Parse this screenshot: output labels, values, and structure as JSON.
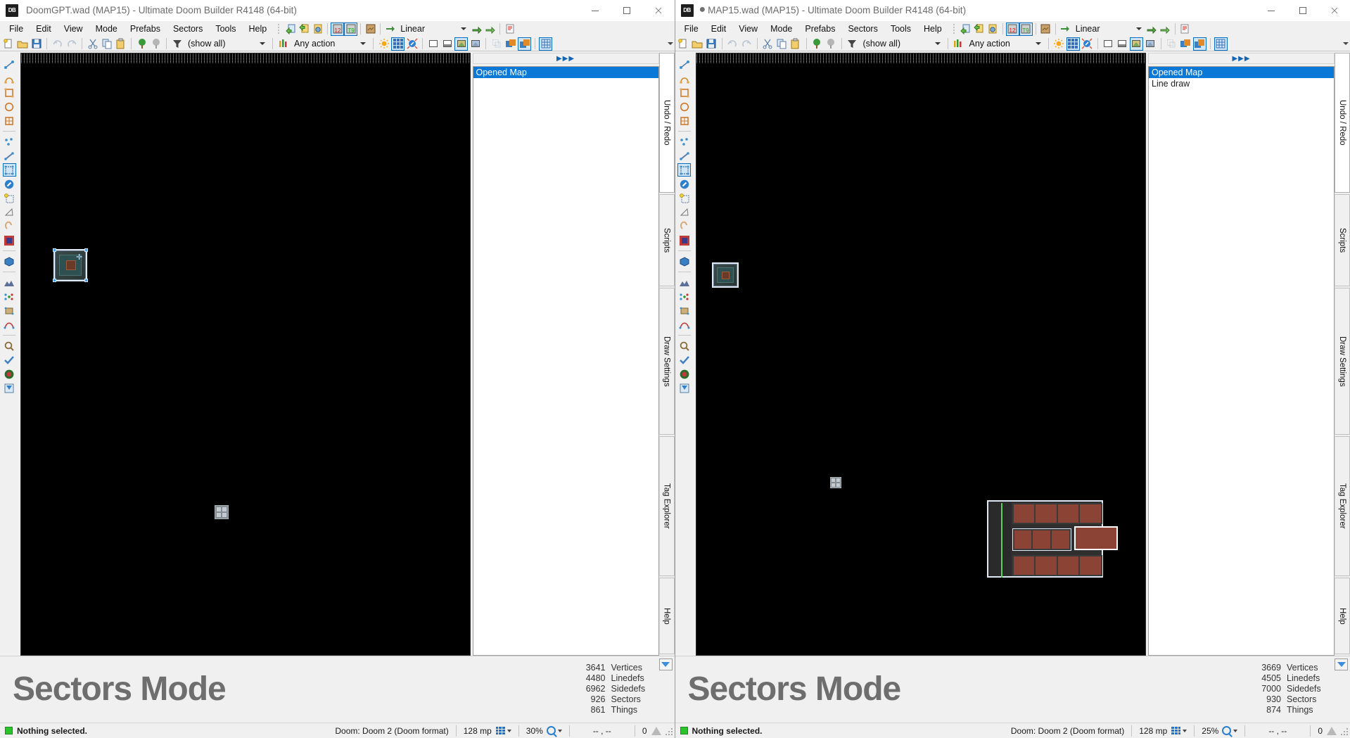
{
  "windows": [
    {
      "id": "left",
      "title": "DoomGPT.wad (MAP15) - Ultimate Doom Builder R4148 (64-bit)",
      "modified": false,
      "modified_marker": "",
      "app_icon_label": "DB",
      "window_buttons": {
        "minimize": "minimize-button",
        "maximize": "maximize-button",
        "close": "close-button"
      },
      "menus": [
        "File",
        "Edit",
        "View",
        "Mode",
        "Prefabs",
        "Sectors",
        "Tools",
        "Help"
      ],
      "toolbar_top": {
        "linedef_mode_label": "12",
        "thing_mode_label": "T9",
        "curve_style": "Linear"
      },
      "toolbar_second": {
        "filter_label": "(show all)",
        "action_label": "Any action"
      },
      "panel": {
        "header_arrows": "▶▶▶",
        "items": [
          {
            "label": "Opened Map",
            "selected": true
          }
        ]
      },
      "vertical_tabs": [
        {
          "label": "Undo / Redo",
          "active": true
        },
        {
          "label": "Scripts",
          "active": false
        },
        {
          "label": "Draw Settings",
          "active": false
        },
        {
          "label": "Tag Explorer",
          "active": false
        },
        {
          "label": "Help",
          "active": false
        }
      ],
      "mode": {
        "title": "Sectors Mode"
      },
      "stats": [
        {
          "value": "3641",
          "label": "Vertices"
        },
        {
          "value": "4480",
          "label": "Linedefs"
        },
        {
          "value": "6962",
          "label": "Sidedefs"
        },
        {
          "value": "926",
          "label": "Sectors"
        },
        {
          "value": "861",
          "label": "Things"
        }
      ],
      "status": {
        "message": "Nothing selected.",
        "game_config": "Doom: Doom 2 (Doom format)",
        "grid_size": "128 mp",
        "zoom": "30%",
        "coordinates": "-- , --",
        "selection_count": "0"
      }
    },
    {
      "id": "right",
      "title": "MAP15.wad (MAP15) - Ultimate Doom Builder R4148 (64-bit)",
      "modified": true,
      "modified_marker": "●",
      "app_icon_label": "DB",
      "window_buttons": {
        "minimize": "minimize-button",
        "maximize": "maximize-button",
        "close": "close-button"
      },
      "menus": [
        "File",
        "Edit",
        "View",
        "Mode",
        "Prefabs",
        "Sectors",
        "Tools",
        "Help"
      ],
      "toolbar_top": {
        "linedef_mode_label": "12",
        "thing_mode_label": "T9",
        "curve_style": "Linear"
      },
      "toolbar_second": {
        "filter_label": "(show all)",
        "action_label": "Any action"
      },
      "panel": {
        "header_arrows": "▶▶▶",
        "items": [
          {
            "label": "Opened Map",
            "selected": true
          },
          {
            "label": "Line draw",
            "selected": false
          }
        ]
      },
      "vertical_tabs": [
        {
          "label": "Undo / Redo",
          "active": true
        },
        {
          "label": "Scripts",
          "active": false
        },
        {
          "label": "Draw Settings",
          "active": false
        },
        {
          "label": "Tag Explorer",
          "active": false
        },
        {
          "label": "Help",
          "active": false
        }
      ],
      "mode": {
        "title": "Sectors Mode"
      },
      "stats": [
        {
          "value": "3669",
          "label": "Vertices"
        },
        {
          "value": "4505",
          "label": "Linedefs"
        },
        {
          "value": "7000",
          "label": "Sidedefs"
        },
        {
          "value": "930",
          "label": "Sectors"
        },
        {
          "value": "874",
          "label": "Things"
        }
      ],
      "status": {
        "message": "Nothing selected.",
        "game_config": "Doom: Doom 2 (Doom format)",
        "grid_size": "128 mp",
        "zoom": "25%",
        "coordinates": "-- , --",
        "selection_count": "0"
      }
    }
  ],
  "colors": {
    "selection_blue": "#0a78d7",
    "canvas_black": "#000000",
    "grid_line": "#555555",
    "grid_major": "#7a7a7a",
    "mode_text": "#6e6e6e",
    "panel_header_text": "#1464b4",
    "status_led_green": "#2bc22b",
    "toolbar_checked_border": "#0a6cbc",
    "sector_brick": "#8a4334",
    "sector_floor": "#3a3a3a"
  }
}
